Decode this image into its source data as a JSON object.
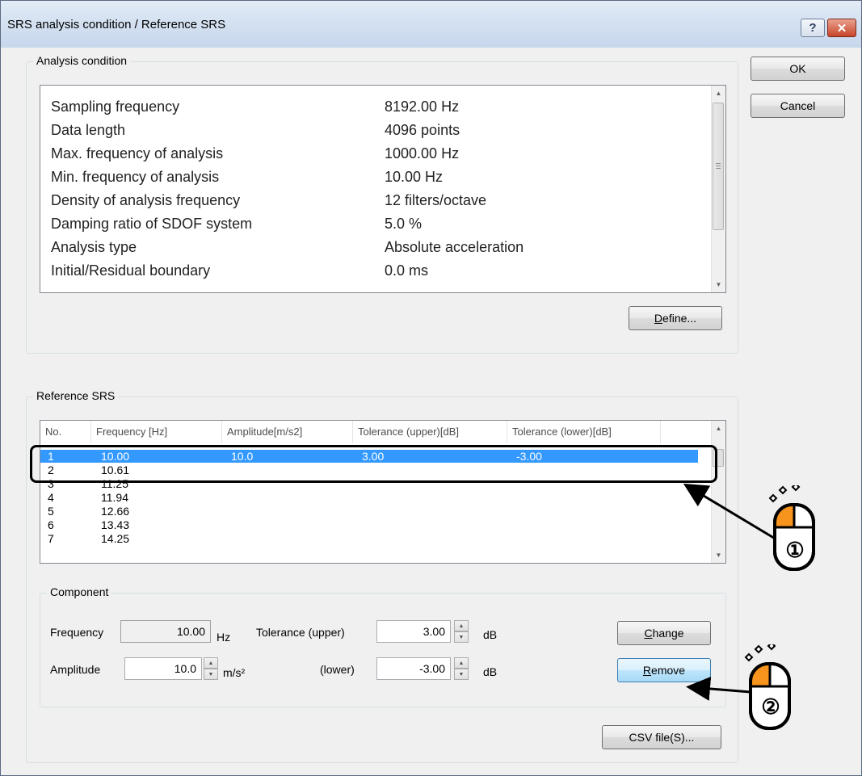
{
  "window": {
    "title": "SRS analysis condition / Reference SRS",
    "help_label": "?",
    "close_label": "✕"
  },
  "buttons": {
    "ok": "OK",
    "cancel": "Cancel",
    "define": "Define...",
    "change": "Change",
    "remove": "Remove",
    "csv": "CSV file(S)..."
  },
  "analysis": {
    "group_label": "Analysis condition",
    "rows": [
      {
        "label": "Sampling frequency",
        "value": "8192.00 Hz"
      },
      {
        "label": "Data length",
        "value": "4096 points"
      },
      {
        "label": "Max. frequency of analysis",
        "value": "1000.00 Hz"
      },
      {
        "label": "Min. frequency of analysis",
        "value": "10.00 Hz"
      },
      {
        "label": "Density of analysis frequency",
        "value": "12 filters/octave"
      },
      {
        "label": "Damping ratio of SDOF system",
        "value": "5.0 %"
      },
      {
        "label": "Analysis type",
        "value": "Absolute acceleration"
      },
      {
        "label": "Initial/Residual boundary",
        "value": "0.0 ms"
      }
    ]
  },
  "reference": {
    "group_label": "Reference SRS",
    "columns": [
      "No.",
      "Frequency [Hz]",
      "Amplitude[m/s2]",
      "Tolerance (upper)[dB]",
      "Tolerance (lower)[dB]"
    ],
    "rows": [
      {
        "no": "1",
        "freq": "10.00",
        "amp": "10.0",
        "upper": "3.00",
        "lower": "-3.00"
      },
      {
        "no": "2",
        "freq": "10.61",
        "amp": "",
        "upper": "",
        "lower": ""
      },
      {
        "no": "3",
        "freq": "11.25",
        "amp": "",
        "upper": "",
        "lower": ""
      },
      {
        "no": "4",
        "freq": "11.94",
        "amp": "",
        "upper": "",
        "lower": ""
      },
      {
        "no": "5",
        "freq": "12.66",
        "amp": "",
        "upper": "",
        "lower": ""
      },
      {
        "no": "6",
        "freq": "13.43",
        "amp": "",
        "upper": "",
        "lower": ""
      },
      {
        "no": "7",
        "freq": "14.25",
        "amp": "",
        "upper": "",
        "lower": ""
      }
    ],
    "selected_row": 1
  },
  "component": {
    "group_label": "Component",
    "frequency_label": "Frequency",
    "frequency_value": "10.00",
    "frequency_unit": "Hz",
    "amplitude_label": "Amplitude",
    "amplitude_value": "10.0",
    "amplitude_unit": "m/s²",
    "tol_upper_label": "Tolerance (upper)",
    "tol_upper_value": "3.00",
    "tol_upper_unit": "dB",
    "tol_lower_label": "(lower)",
    "tol_lower_value": "-3.00",
    "tol_lower_unit": "dB"
  },
  "annotations": {
    "step1": "①",
    "step2": "②",
    "accent_color": "#f7941d"
  }
}
